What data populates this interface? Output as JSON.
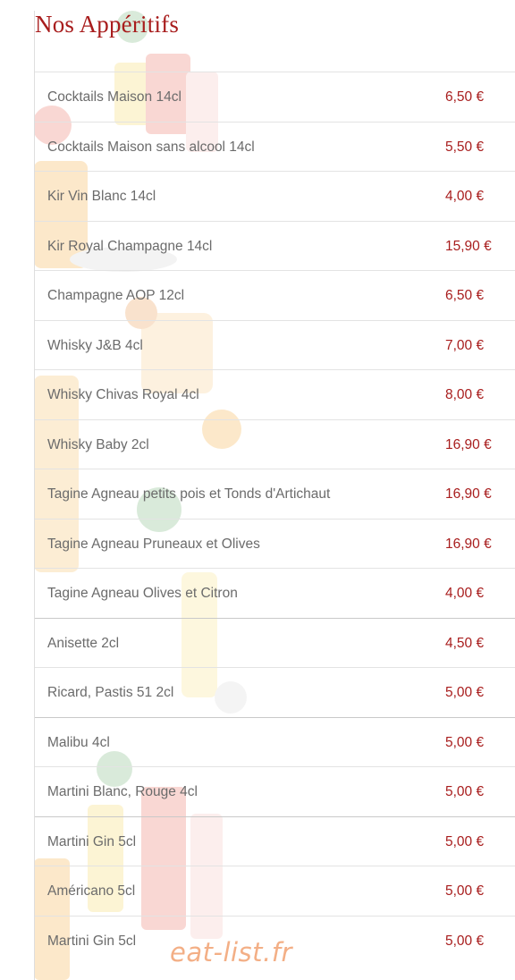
{
  "page": {
    "title": "Nos Appéritifs"
  },
  "menu": {
    "items": [
      {
        "name": "Cocktails Maison 14cl",
        "price": "6,50 €"
      },
      {
        "name": "Cocktails Maison sans alcool 14cl",
        "price": "5,50 €"
      },
      {
        "name": "Kir Vin Blanc 14cl",
        "price": "4,00 €"
      },
      {
        "name": "Kir Royal Champagne 14cl",
        "price": "15,90 €"
      },
      {
        "name": "Champagne AOP 12cl",
        "price": "6,50 €"
      },
      {
        "name": "Whisky J&B 4cl",
        "price": "7,00 €"
      },
      {
        "name": "Whisky Chivas Royal 4cl",
        "price": "8,00 €"
      },
      {
        "name": "Whisky Baby 2cl",
        "price": "16,90 €"
      },
      {
        "name": "Tagine Agneau petits pois et Tonds d'Artichaut",
        "price": "16,90 €"
      },
      {
        "name": "Tagine Agneau Pruneaux et Olives",
        "price": "16,90 €"
      },
      {
        "name": "Tagine Agneau Olives et Citron",
        "price": "4,00 €"
      },
      {
        "name": "Anisette 2cl",
        "price": "4,50 €"
      },
      {
        "name": "Ricard, Pastis 51 2cl",
        "price": "5,00 €"
      },
      {
        "name": "Malibu 4cl",
        "price": "5,00 €"
      },
      {
        "name": "Martini Blanc, Rouge 4cl",
        "price": "5,00 €"
      },
      {
        "name": "Martini Gin 5cl",
        "price": "5,00 €"
      },
      {
        "name": "Américano 5cl",
        "price": "5,00 €"
      },
      {
        "name": "Martini Gin 5cl",
        "price": "5,00 €"
      }
    ]
  },
  "watermark": {
    "text": "eat-list.fr"
  },
  "colors": {
    "accent": "#a81d1d",
    "item_text": "#6b6b6b",
    "watermark": "#f2a271"
  }
}
